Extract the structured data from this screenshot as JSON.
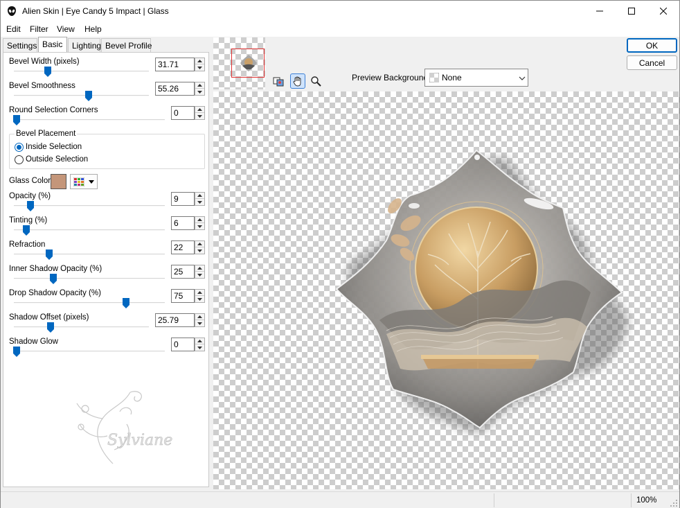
{
  "window": {
    "title": "Alien Skin | Eye Candy 5 Impact | Glass"
  },
  "menu": [
    "Edit",
    "Filter",
    "View",
    "Help"
  ],
  "tabs": [
    "Settings",
    "Basic",
    "Lighting",
    "Bevel Profile"
  ],
  "active_tab": "Basic",
  "controls": [
    {
      "label": "Bevel Width (pixels)",
      "value": "31.71",
      "slider_fraction": 0.25
    },
    {
      "label": "Bevel Smoothness",
      "value": "55.26",
      "slider_fraction": 0.55
    },
    {
      "label": "Round Selection Corners",
      "value": "0",
      "slider_fraction": 0.0
    },
    {
      "label": "Opacity (%)",
      "value": "9",
      "slider_fraction": 0.09
    },
    {
      "label": "Tinting (%)",
      "value": "6",
      "slider_fraction": 0.06
    },
    {
      "label": "Refraction",
      "value": "22",
      "slider_fraction": 0.22
    },
    {
      "label": "Inner Shadow Opacity (%)",
      "value": "25",
      "slider_fraction": 0.25
    },
    {
      "label": "Drop Shadow Opacity (%)",
      "value": "75",
      "slider_fraction": 0.75
    },
    {
      "label": "Shadow Offset (pixels)",
      "value": "25.79",
      "slider_fraction": 0.26
    },
    {
      "label": "Shadow Glow",
      "value": "0",
      "slider_fraction": 0.0
    }
  ],
  "bevel_placement": {
    "title": "Bevel Placement",
    "options": [
      "Inside Selection",
      "Outside Selection"
    ],
    "selected": "Inside Selection"
  },
  "glass_color": {
    "label": "Glass Color",
    "color": "#c4967a"
  },
  "preview_background": {
    "label": "Preview Background:",
    "value": "None"
  },
  "buttons": {
    "ok": "OK",
    "cancel": "Cancel"
  },
  "watermark": "Sylviane",
  "status": {
    "zoom": "100%"
  },
  "colors": {
    "accent": "#0067c0",
    "thumb_outline": "#e03030"
  }
}
